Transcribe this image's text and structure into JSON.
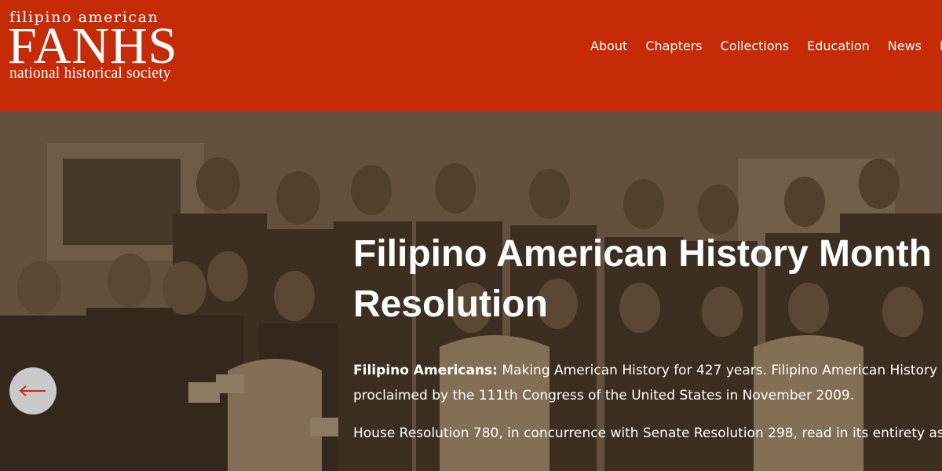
{
  "logo": {
    "top_text": "filipino american",
    "main_text": "FANHS",
    "bottom_text": "national historical society"
  },
  "nav": {
    "items": [
      "About",
      "Chapters",
      "Collections",
      "Education",
      "News",
      "E"
    ]
  },
  "hero": {
    "title": "Filipino American History Month Resolution",
    "paragraph1": {
      "bold": "Filipino Americans:",
      "line1_rest": " Making American History for 427 years. Filipino American History Mo",
      "line2": "proclaimed by the 111th Congress of the United States in November 2009."
    },
    "paragraph2": "House Resolution 780, in concurrence with Senate Resolution 298, read in its entirety as",
    "prev_icon": "left-arrow-icon"
  },
  "colors": {
    "header_bg": "#c42b06",
    "arrow_button_bg": "#c9c9c9",
    "arrow_color": "#c42b06"
  }
}
